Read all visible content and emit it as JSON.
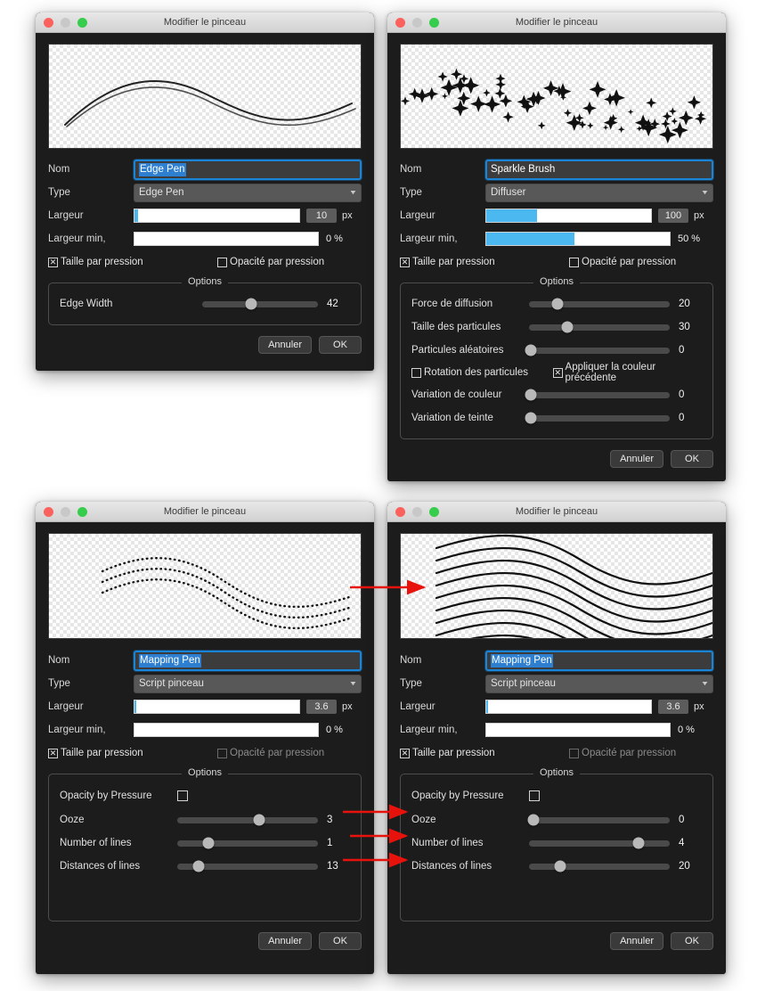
{
  "window_title": "Modifier le pinceau",
  "labels": {
    "nom": "Nom",
    "type": "Type",
    "largeur": "Largeur",
    "largeur_min": "Largeur min,",
    "taille_par_pression": "Taille par pression",
    "opacite_par_pression": "Opacité par pression",
    "options": "Options",
    "px": "px",
    "cancel": "Annuler",
    "ok": "OK"
  },
  "windows": [
    {
      "id": "edge-pen",
      "name_value": "Edge Pen",
      "type_value": "Edge Pen",
      "largeur_value": "10",
      "largeur_percent": 2,
      "largeur_min_value": "0 %",
      "largeur_min_percent": 0,
      "size_by_pressure": true,
      "opacity_by_pressure": false,
      "opacity_dim": false,
      "options": [
        {
          "label": "Edge Width",
          "value": "42",
          "percent": 42
        }
      ],
      "option_checkboxes": [],
      "preview": "edge-pen-stroke"
    },
    {
      "id": "sparkle-brush",
      "name_value": "Sparkle Brush",
      "type_value": "Diffuser",
      "largeur_value": "100",
      "largeur_percent": 31,
      "largeur_min_value": "50 %",
      "largeur_min_percent": 48,
      "size_by_pressure": true,
      "opacity_by_pressure": false,
      "opacity_dim": false,
      "options": [
        {
          "label": "Force de diffusion",
          "value": "20",
          "percent": 20
        },
        {
          "label": "Taille des particules",
          "value": "30",
          "percent": 27
        },
        {
          "label": "Particules aléatoires",
          "value": "0",
          "percent": 0
        },
        {
          "label": "Variation de couleur",
          "value": "0",
          "percent": 0
        },
        {
          "label": "Variation de teinte",
          "value": "0",
          "percent": 0
        }
      ],
      "option_checkboxes": [
        {
          "label": "Rotation des particules",
          "checked": false
        },
        {
          "label": "Appliquer la couleur précédente",
          "checked": true
        }
      ],
      "preview": "sparkle-stroke"
    },
    {
      "id": "mapping-pen-before",
      "name_value": "Mapping Pen",
      "type_value": "Script pinceau",
      "largeur_value": "3.6",
      "largeur_percent": 1,
      "largeur_min_value": "0 %",
      "largeur_min_percent": 0,
      "size_by_pressure": true,
      "opacity_by_pressure": false,
      "opacity_dim": true,
      "options": [
        {
          "label": "Ooze",
          "value": "3",
          "percent": 58
        },
        {
          "label": "Number of lines",
          "value": "1",
          "percent": 22
        },
        {
          "label": "Distances of lines",
          "value": "13",
          "percent": 15
        }
      ],
      "option_checkboxes": [
        {
          "label": "Opacity by Pressure",
          "checked": false
        }
      ],
      "preview": "dotted-stroke"
    },
    {
      "id": "mapping-pen-after",
      "name_value": "Mapping Pen",
      "type_value": "Script pinceau",
      "largeur_value": "3.6",
      "largeur_percent": 1,
      "largeur_min_value": "0 %",
      "largeur_min_percent": 0,
      "size_by_pressure": true,
      "opacity_by_pressure": false,
      "opacity_dim": true,
      "options": [
        {
          "label": "Ooze",
          "value": "0",
          "percent": 3
        },
        {
          "label": "Number of lines",
          "value": "4",
          "percent": 78
        },
        {
          "label": "Distances of lines",
          "value": "20",
          "percent": 22
        }
      ],
      "option_checkboxes": [
        {
          "label": "Opacity by Pressure",
          "checked": false
        }
      ],
      "preview": "multiline-stroke"
    }
  ],
  "annotation": {
    "color": "#e8120c",
    "arrow_count": 4
  }
}
